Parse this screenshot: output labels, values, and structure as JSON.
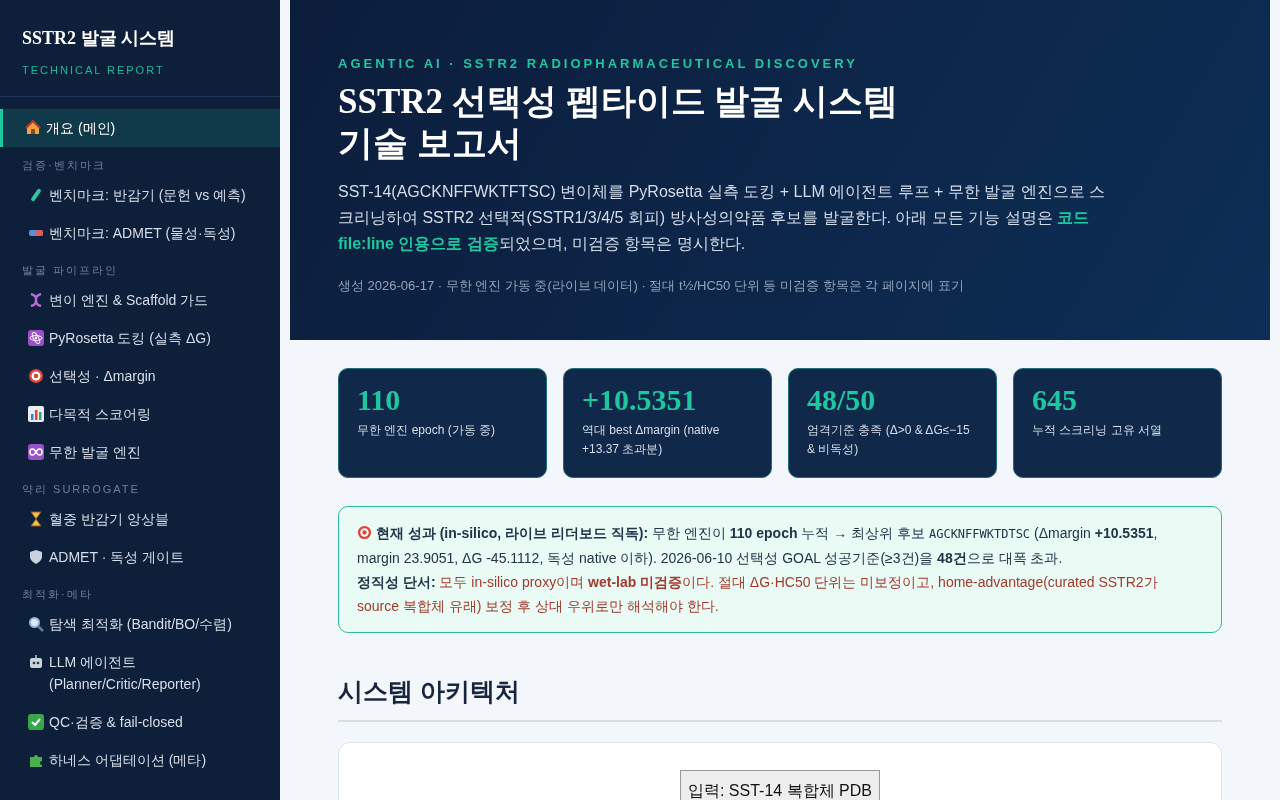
{
  "sidebar": {
    "title": "SSTR2 발굴 시스템",
    "subtitle": "TECHNICAL REPORT",
    "sections": [
      {
        "items": [
          {
            "label": "개요 (메인)",
            "selected": true
          }
        ]
      },
      {
        "label": "검증·벤치마크",
        "items": [
          {
            "label": "벤치마크: 반감기 (문헌 vs 예측)",
            "selected": false
          },
          {
            "label": "벤치마크: ADMET (물성·독성)",
            "selected": false
          }
        ]
      },
      {
        "label": "발굴 파이프라인",
        "items": [
          {
            "label": "변이 엔진 & Scaffold 가드",
            "selected": false
          },
          {
            "label": "PyRosetta 도킹 (실측 ΔG)",
            "selected": false
          },
          {
            "label": "선택성 · Δmargin",
            "selected": false
          },
          {
            "label": "다목적 스코어링",
            "selected": false
          },
          {
            "label": "무한 발굴 엔진",
            "selected": false
          }
        ]
      },
      {
        "label": "약리 SURROGATE",
        "items": [
          {
            "label": "혈중 반감기 앙상블",
            "selected": false
          },
          {
            "label": "ADMET · 독성 게이트",
            "selected": false
          }
        ]
      },
      {
        "label": "최적화·메타",
        "items": [
          {
            "label": "탐색 최적화 (Bandit/BO/수렴)",
            "selected": false
          },
          {
            "label": "LLM 에이전트 (Planner/Critic/Reporter)",
            "selected": false
          },
          {
            "label": "QC·검증 & fail-closed",
            "selected": false
          },
          {
            "label": "하네스 어댑테이션 (메타)",
            "selected": false
          }
        ]
      }
    ]
  },
  "hero": {
    "eyebrow": "AGENTIC AI · SSTR2 RADIOPHARMACEUTICAL DISCOVERY",
    "title": "SSTR2 선택성 펩타이드 발굴 시스템 기술 보고서",
    "description": "SST-14(AGCKNFFWKTFTSC) 변이체를 PyRosetta 실측 도킹 + LLM 에이전트 루프 + 무한 발굴 엔진으로 스크리닝하여 SSTR2 선택적(SSTR1/3/4/5 회피) 방사성의약품 후보를 발굴한다. 아래 모든 기능 설명은 **코드 file:line 인용으로 검증**되었으며, 미검증 항목은 명시한다.",
    "meta": "생성 2026-06-17 · 무한 엔진 가동 중(라이브 데이터) · 절대 t½/HC50 단위 등 미검증 항목은 각 페이지에 표기"
  },
  "stats": [
    {
      "value": "110",
      "label": "무한 엔진 epoch (가동 중)"
    },
    {
      "value": "+10.5351",
      "label": "역대 best Δmargin (native +13.37 초과분)"
    },
    {
      "value": "48/50",
      "label": "엄격기준 충족 (Δ>0 & ΔG≤−15 & 비독성)"
    },
    {
      "value": "645",
      "label": "누적 스크리닝 고유 서열"
    }
  ],
  "callout": {
    "lead": "현재 성과 (in-silico, 라이브 리더보드 직독):",
    "text_1": "무한 엔진이 **110 epoch** 누적 → 최상위 후보",
    "sequence": "AGCKNFFWKTDTSC",
    "text_2": "(Δmargin **+10.5351**, margin 23.9051, ΔG -45.1112, 독성 native 이하). 2026-06-10 선택성 GOAL 성공기준(≥3건)을 **48건**으로 대폭 초과.",
    "caveat_lead": "정직성 단서:",
    "caveat": "모두 in-silico proxy이며 **wet-lab 미검증**이다. 절대 ΔG·HC50 단위는 미보정이고, home-advantage(curated SSTR2가 source 복합체 유래) 보정 후 상대 우위로만 해석해야 한다."
  },
  "architecture": {
    "heading": "시스템 아키텍처",
    "nodes": [
      "입력: SST-14 복합체 PDB"
    ]
  }
}
